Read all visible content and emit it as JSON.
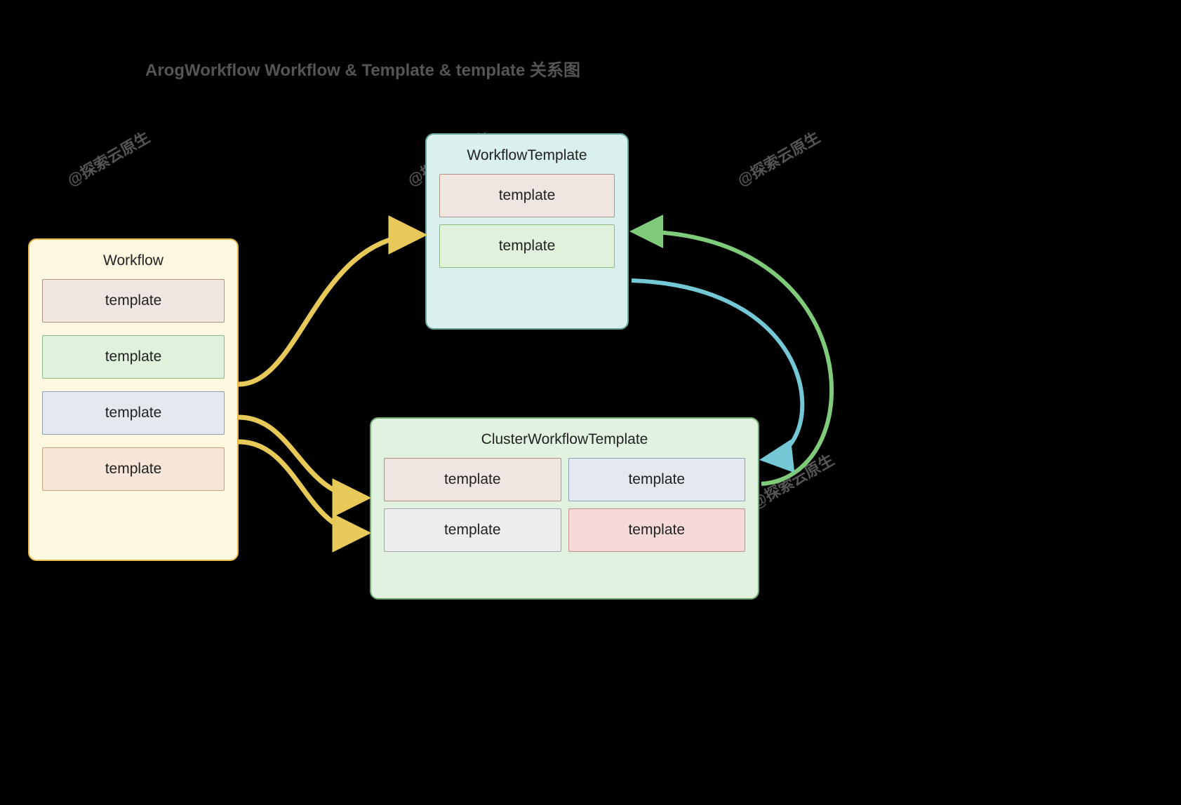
{
  "title": "ArogWorkflow Workflow & Template & template 关系图",
  "watermark_text": "@探索云原生",
  "workflow": {
    "label": "Workflow",
    "templates": [
      "template",
      "template",
      "template",
      "template"
    ]
  },
  "workflowTemplate": {
    "label": "WorkflowTemplate",
    "templates": [
      "template",
      "template"
    ]
  },
  "clusterWorkflowTemplate": {
    "label": "ClusterWorkflowTemplate",
    "templates": [
      "template",
      "template",
      "template",
      "template"
    ]
  },
  "arrows": {
    "workflow_to_wft": {
      "color": "#E7C95A"
    },
    "workflow_to_cwft1": {
      "color": "#E7C95A"
    },
    "workflow_to_cwft2": {
      "color": "#E7C95A"
    },
    "cwft_to_wft_right1": {
      "color": "#7FCB7A"
    },
    "cwft_to_wft_right2": {
      "color": "#74C7D4"
    }
  },
  "colors": {
    "workflow_bg": "#FFF8E1",
    "wft_bg": "#D9F0EE",
    "cwft_bg": "#E1F2E0"
  }
}
